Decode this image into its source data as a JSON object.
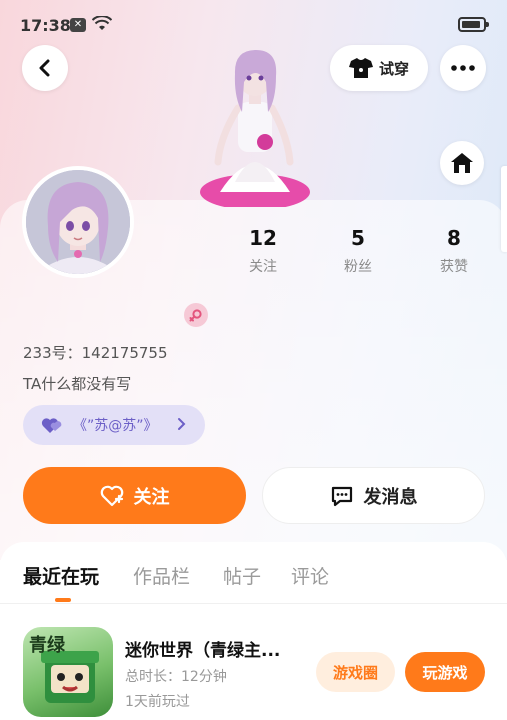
{
  "status_bar": {
    "time": "17:38",
    "notification_glyph": "✕"
  },
  "header": {
    "tryon_label": "试穿",
    "icons": {
      "back": "back-chevron-icon",
      "more": "more-dots-icon",
      "home": "home-icon",
      "tryon": "tshirt-icon"
    }
  },
  "profile": {
    "stats": [
      {
        "value": "12",
        "label": "关注"
      },
      {
        "value": "5",
        "label": "粉丝"
      },
      {
        "value": "8",
        "label": "获赞"
      }
    ],
    "id_text": "233号：142175755",
    "bio": "TA什么都没有写",
    "group_label": "《”苏@苏”》",
    "gender": "female"
  },
  "actions": {
    "follow_label": "关注",
    "message_label": "发消息"
  },
  "tabs": [
    {
      "label": "最近在玩",
      "active": true
    },
    {
      "label": "作品栏",
      "active": false
    },
    {
      "label": "帖子",
      "active": false
    },
    {
      "label": "评论",
      "active": false
    }
  ],
  "game": {
    "title": "迷你世界（青绿主...",
    "duration": "总时长：12分钟",
    "last_played": "1天前玩过",
    "circle_label": "游戏圈",
    "play_label": "玩游戏",
    "icon_text": "青绿"
  },
  "colors": {
    "accent": "#ff7a1a",
    "group_bg": "#e3e0f7",
    "group_text": "#6c5fc7"
  }
}
